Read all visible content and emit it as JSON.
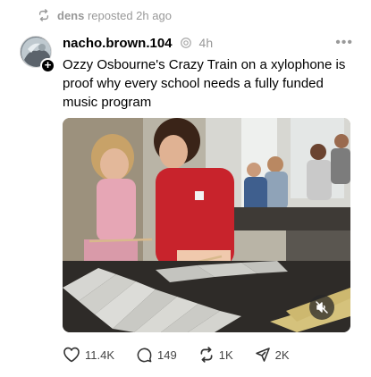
{
  "repost": {
    "user": "dens",
    "text": "reposted 2h ago"
  },
  "post": {
    "username": "nacho.brown.104",
    "time": "4h",
    "text": "Ozzy Osbourne's Crazy Train on a xylophone is proof why every school needs a fully funded music program"
  },
  "actions": {
    "likes": "11.4K",
    "comments": "149",
    "reposts": "1K",
    "shares": "2K"
  },
  "icons": {
    "repost": "repost-icon",
    "verified": "verified-icon",
    "more": "more-icon",
    "mute": "muted-speaker-icon",
    "like": "heart-icon",
    "comment": "comment-icon",
    "share": "send-icon"
  }
}
